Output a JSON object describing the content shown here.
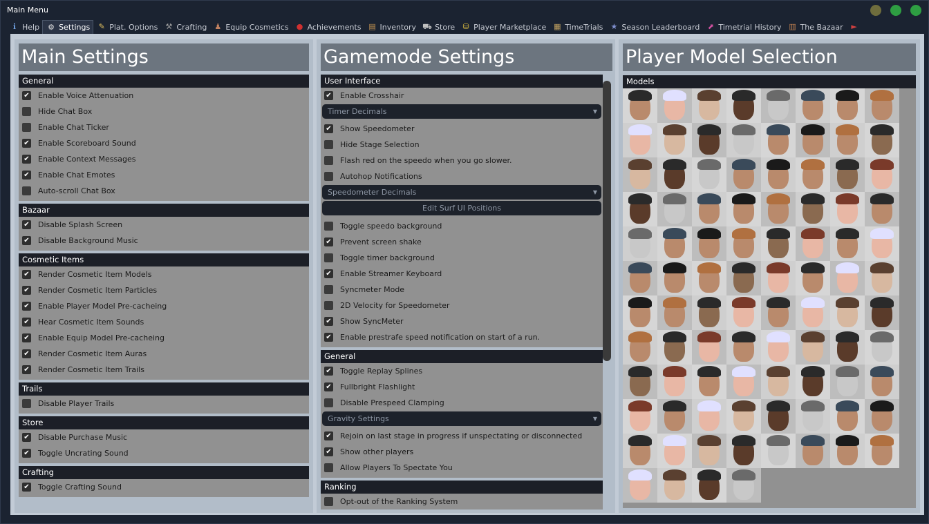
{
  "window": {
    "title": "Main Menu",
    "buttons": [
      {
        "name": "minimize-button",
        "color": "#7a7a3e"
      },
      {
        "name": "maximize-button",
        "color": "#2e9e42"
      },
      {
        "name": "close-button",
        "color": "#2e9e42"
      }
    ]
  },
  "tabs": [
    {
      "label": "Help",
      "icon": "info-icon",
      "active": false
    },
    {
      "label": "Settings",
      "icon": "gear-icon",
      "active": true
    },
    {
      "label": "Plat. Options",
      "icon": "pencil-icon",
      "active": false
    },
    {
      "label": "Crafting",
      "icon": "wrench-icon",
      "active": false
    },
    {
      "label": "Equip Cosmetics",
      "icon": "person-icon",
      "active": false
    },
    {
      "label": "Achievements",
      "icon": "medal-icon",
      "active": false
    },
    {
      "label": "Inventory",
      "icon": "chest-icon",
      "active": false
    },
    {
      "label": "Store",
      "icon": "cart-icon",
      "active": false
    },
    {
      "label": "Player Marketplace",
      "icon": "coins-icon",
      "active": false
    },
    {
      "label": "TimeTrials",
      "icon": "clipboard-icon",
      "active": false
    },
    {
      "label": "Season Leaderboard",
      "icon": "star-icon",
      "active": false
    },
    {
      "label": "Timetrial History",
      "icon": "graph-icon",
      "active": false
    },
    {
      "label": "The Bazaar",
      "icon": "building-icon",
      "active": false
    },
    {
      "label": "",
      "icon": "more-icon",
      "active": false
    }
  ],
  "main_settings": {
    "title": "Main Settings",
    "sections": [
      {
        "title": "General",
        "items": [
          {
            "label": "Enable Voice Attenuation",
            "checked": true
          },
          {
            "label": "Hide Chat Box",
            "checked": false
          },
          {
            "label": "Enable Chat Ticker",
            "checked": false
          },
          {
            "label": "Enable Scoreboard Sound",
            "checked": true
          },
          {
            "label": "Enable Context Messages",
            "checked": true
          },
          {
            "label": "Enable Chat Emotes",
            "checked": true
          },
          {
            "label": "Auto-scroll Chat Box",
            "checked": false
          }
        ]
      },
      {
        "title": "Bazaar",
        "items": [
          {
            "label": "Disable Splash Screen",
            "checked": true
          },
          {
            "label": "Disable Background Music",
            "checked": true
          }
        ]
      },
      {
        "title": "Cosmetic Items",
        "items": [
          {
            "label": "Render Cosmetic Item Models",
            "checked": true
          },
          {
            "label": "Render Cosmetic Item Particles",
            "checked": true
          },
          {
            "label": "Enable Player Model Pre-cacheing",
            "checked": true
          },
          {
            "label": "Hear Cosmetic Item Sounds",
            "checked": true
          },
          {
            "label": "Enable Equip Model Pre-cacheing",
            "checked": true
          },
          {
            "label": "Render Cosmetic Item Auras",
            "checked": true
          },
          {
            "label": "Render Cosmetic Item Trails",
            "checked": true
          }
        ]
      },
      {
        "title": "Trails",
        "items": [
          {
            "label": "Disable Player Trails",
            "checked": false
          }
        ]
      },
      {
        "title": "Store",
        "items": [
          {
            "label": "Disable Purchase Music",
            "checked": true
          },
          {
            "label": "Toggle Uncrating Sound",
            "checked": true
          }
        ]
      },
      {
        "title": "Crafting",
        "items": [
          {
            "label": "Toggle Crafting Sound",
            "checked": true
          }
        ]
      }
    ]
  },
  "gamemode_settings": {
    "title": "Gamemode Settings",
    "ui_section": "User Interface",
    "ui_items": [
      {
        "kind": "check",
        "label": "Enable Crosshair",
        "checked": true
      },
      {
        "kind": "dropdown",
        "label": "Timer Decimals"
      },
      {
        "kind": "check",
        "label": "Show Speedometer",
        "checked": true
      },
      {
        "kind": "check",
        "label": "Hide Stage Selection",
        "checked": false
      },
      {
        "kind": "check",
        "label": "Flash red on the speedo when you go slower.",
        "checked": false
      },
      {
        "kind": "check",
        "label": "Autohop Notifications",
        "checked": false
      },
      {
        "kind": "dropdown",
        "label": "Speedometer Decimals"
      },
      {
        "kind": "button",
        "label": "Edit Surf UI Positions"
      },
      {
        "kind": "check",
        "label": "Toggle speedo background",
        "checked": false
      },
      {
        "kind": "check",
        "label": "Prevent screen shake",
        "checked": true
      },
      {
        "kind": "check",
        "label": "Toggle timer background",
        "checked": false
      },
      {
        "kind": "check",
        "label": "Enable Streamer Keyboard",
        "checked": true
      },
      {
        "kind": "check",
        "label": "Syncmeter Mode",
        "checked": false
      },
      {
        "kind": "check",
        "label": "2D Velocity for Speedometer",
        "checked": false
      },
      {
        "kind": "check",
        "label": "Show SyncMeter",
        "checked": true
      },
      {
        "kind": "check",
        "label": "Enable prestrafe speed notification on start of a run.",
        "checked": true
      }
    ],
    "general_section": "General",
    "general_items": [
      {
        "kind": "check",
        "label": "Toggle Replay Splines",
        "checked": true
      },
      {
        "kind": "check",
        "label": "Fullbright Flashlight",
        "checked": true
      },
      {
        "kind": "check",
        "label": "Disable Prespeed Clamping",
        "checked": false
      },
      {
        "kind": "dropdown",
        "label": "Gravity Settings"
      },
      {
        "kind": "check",
        "label": "Rejoin on last stage in progress if unspectating or disconnected",
        "checked": true
      },
      {
        "kind": "check",
        "label": "Show other players",
        "checked": true
      },
      {
        "kind": "check",
        "label": "Allow Players To Spectate You",
        "checked": false
      }
    ],
    "ranking_section": "Ranking",
    "ranking_items": [
      {
        "kind": "check",
        "label": "Opt-out of the Ranking System",
        "checked": false
      }
    ]
  },
  "player_models": {
    "title": "Player Model Selection",
    "section": "Models",
    "count": 92,
    "colors": {
      "background": "#919191",
      "skin": "#b98a6c",
      "dark_skin": "#5a3b2a",
      "hair": "#2a2a2a",
      "mask": "#1a1a1a",
      "anime": "#e8b7a5"
    }
  },
  "colors": {
    "window_bg": "#1b2331",
    "content_bg": "#c2cbd6",
    "panel_bg": "#b2bdc9",
    "panel_head": "#6c757f",
    "section_head": "#1c1f27",
    "section_body": "#919191"
  }
}
